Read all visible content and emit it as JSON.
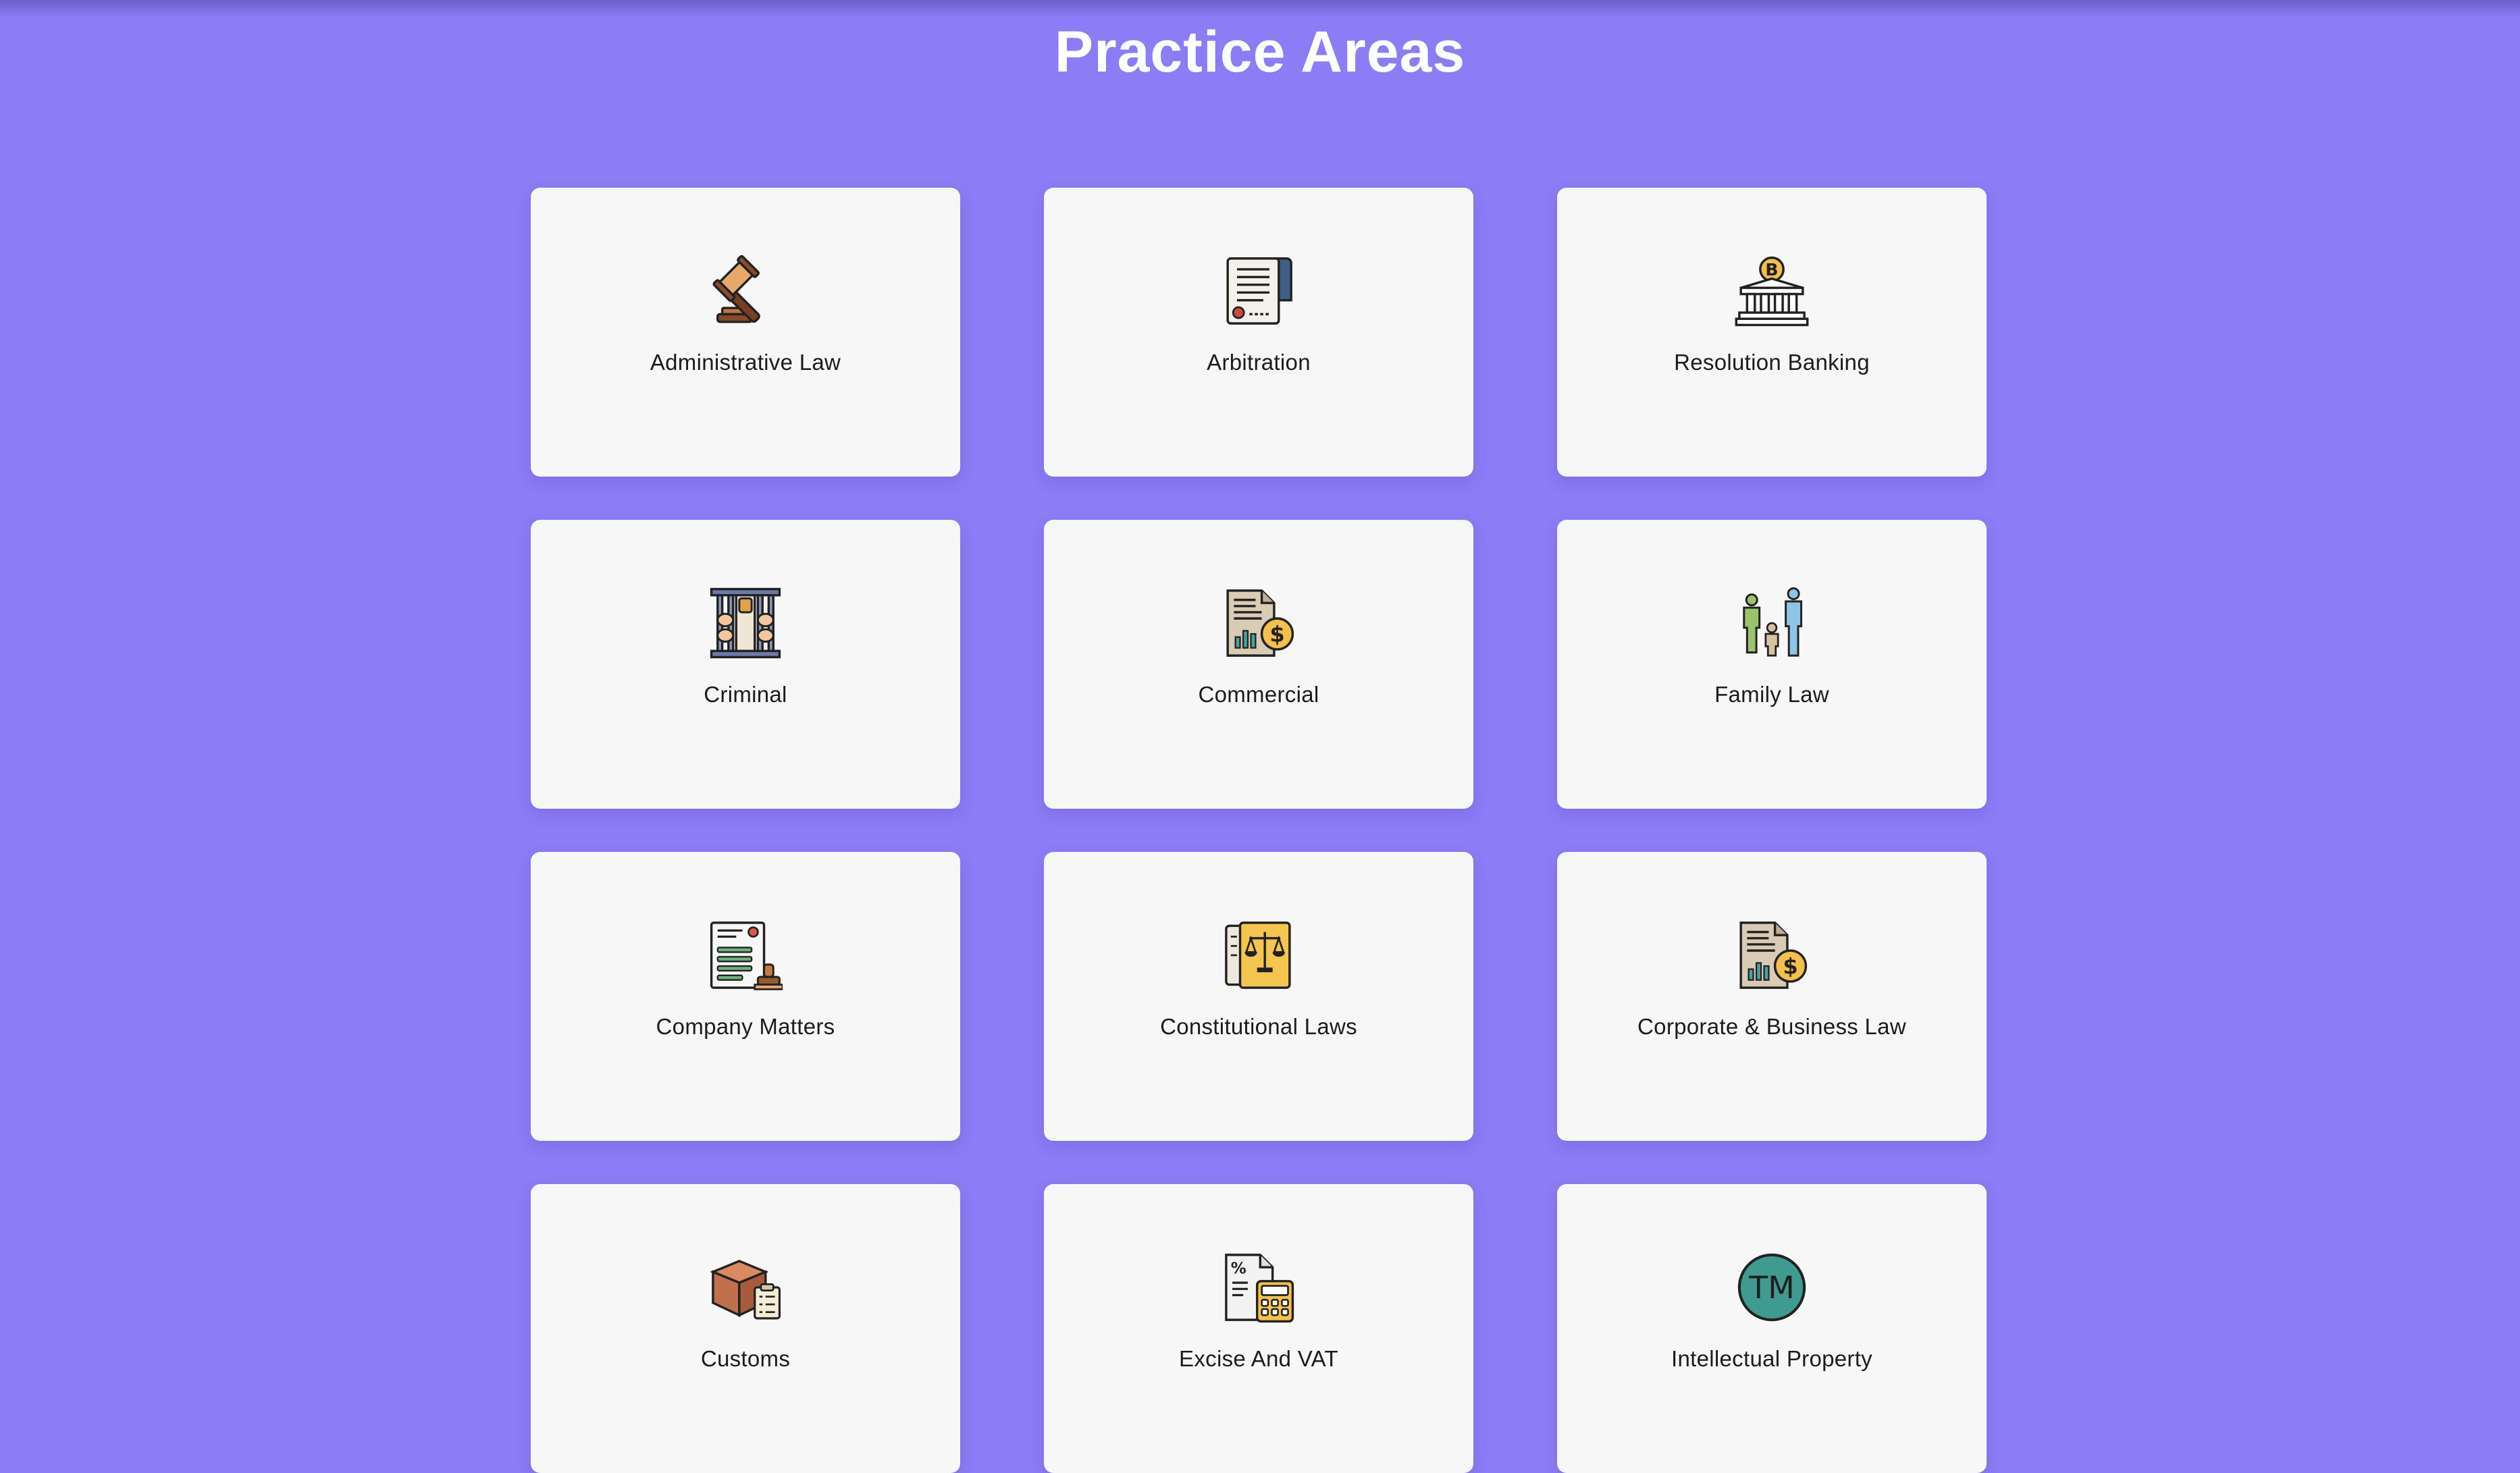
{
  "page": {
    "title": "Practice Areas",
    "background_color": "#8c7cf6",
    "card_color": "#f7f7f7"
  },
  "practice_areas": [
    {
      "label": "Administrative Law",
      "icon": "gavel-icon"
    },
    {
      "label": "Arbitration",
      "icon": "certificate-scroll-icon"
    },
    {
      "label": "Resolution Banking",
      "icon": "bitcoin-bank-icon"
    },
    {
      "label": "Criminal",
      "icon": "jail-bars-icon"
    },
    {
      "label": "Commercial",
      "icon": "finance-report-icon"
    },
    {
      "label": "Family Law",
      "icon": "family-icon"
    },
    {
      "label": "Company Matters",
      "icon": "document-stamp-icon"
    },
    {
      "label": "Constitutional Laws",
      "icon": "law-book-scales-icon"
    },
    {
      "label": "Corporate & Business Law",
      "icon": "finance-report-icon"
    },
    {
      "label": "Customs",
      "icon": "package-checklist-icon"
    },
    {
      "label": "Excise And VAT",
      "icon": "tax-calculator-icon"
    },
    {
      "label": "Intellectual Property",
      "icon": "trademark-icon"
    }
  ]
}
